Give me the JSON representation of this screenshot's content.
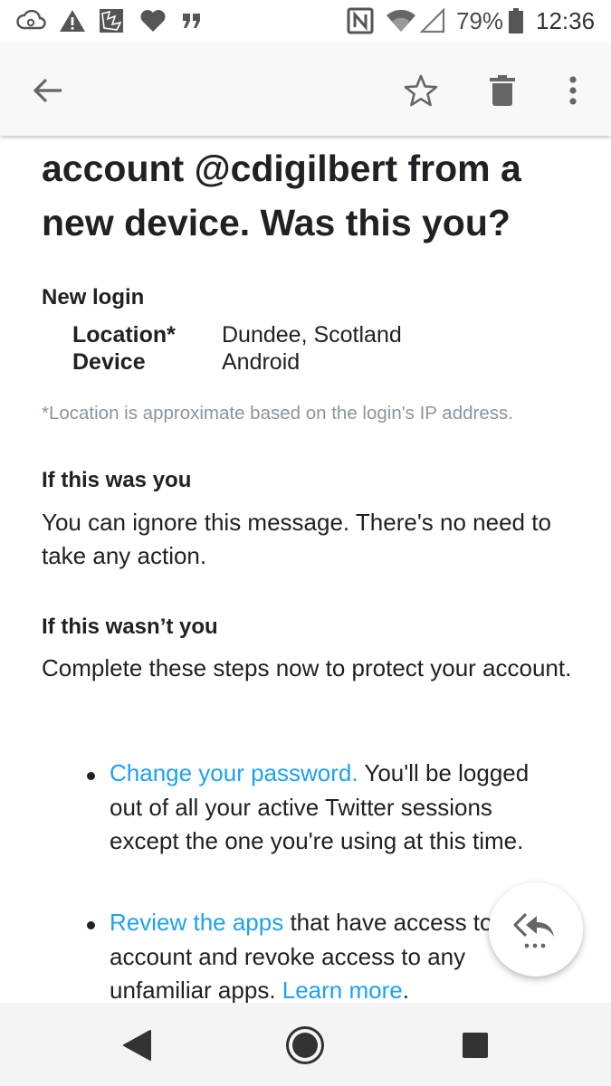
{
  "status_bar": {
    "battery_percent": "79%",
    "time": "12:36",
    "icons": [
      "cloud-sync-icon",
      "warning-icon",
      "app-notification-icon",
      "heart-icon",
      "quote-icon",
      "nfc-icon",
      "wifi-icon",
      "signal-icon",
      "battery-icon"
    ]
  },
  "toolbar": {
    "icons": [
      "back-arrow-icon",
      "star-icon",
      "delete-icon",
      "more-vert-icon"
    ]
  },
  "email": {
    "title": "account @cdigilbert from a new device. Was this you?",
    "new_login_heading": "New login",
    "location_label": "Location*",
    "location_value": "Dundee, Scotland",
    "device_label": "Device",
    "device_value": "Android",
    "location_note": "*Location is approximate based on the login's IP address.",
    "was_you_heading": "If this was you",
    "was_you_text": "You can ignore this message. There's no need to take any action.",
    "wasnt_you_heading": "If this wasn’t you",
    "wasnt_you_text": "Complete these steps now to protect your account.",
    "steps": [
      {
        "link": "Change your password.",
        "text": " You'll be logged out of all your active Twitter sessions except the one you're using at this time."
      },
      {
        "link": "Review the apps",
        "text": " that have access to your account and revoke access to any unfamiliar apps. ",
        "link2": "Learn more",
        "tail": "."
      }
    ]
  },
  "fab": {
    "icon": "reply-all-icon"
  },
  "nav_bar": {
    "icons": [
      "nav-back-icon",
      "nav-home-icon",
      "nav-recents-icon"
    ]
  }
}
